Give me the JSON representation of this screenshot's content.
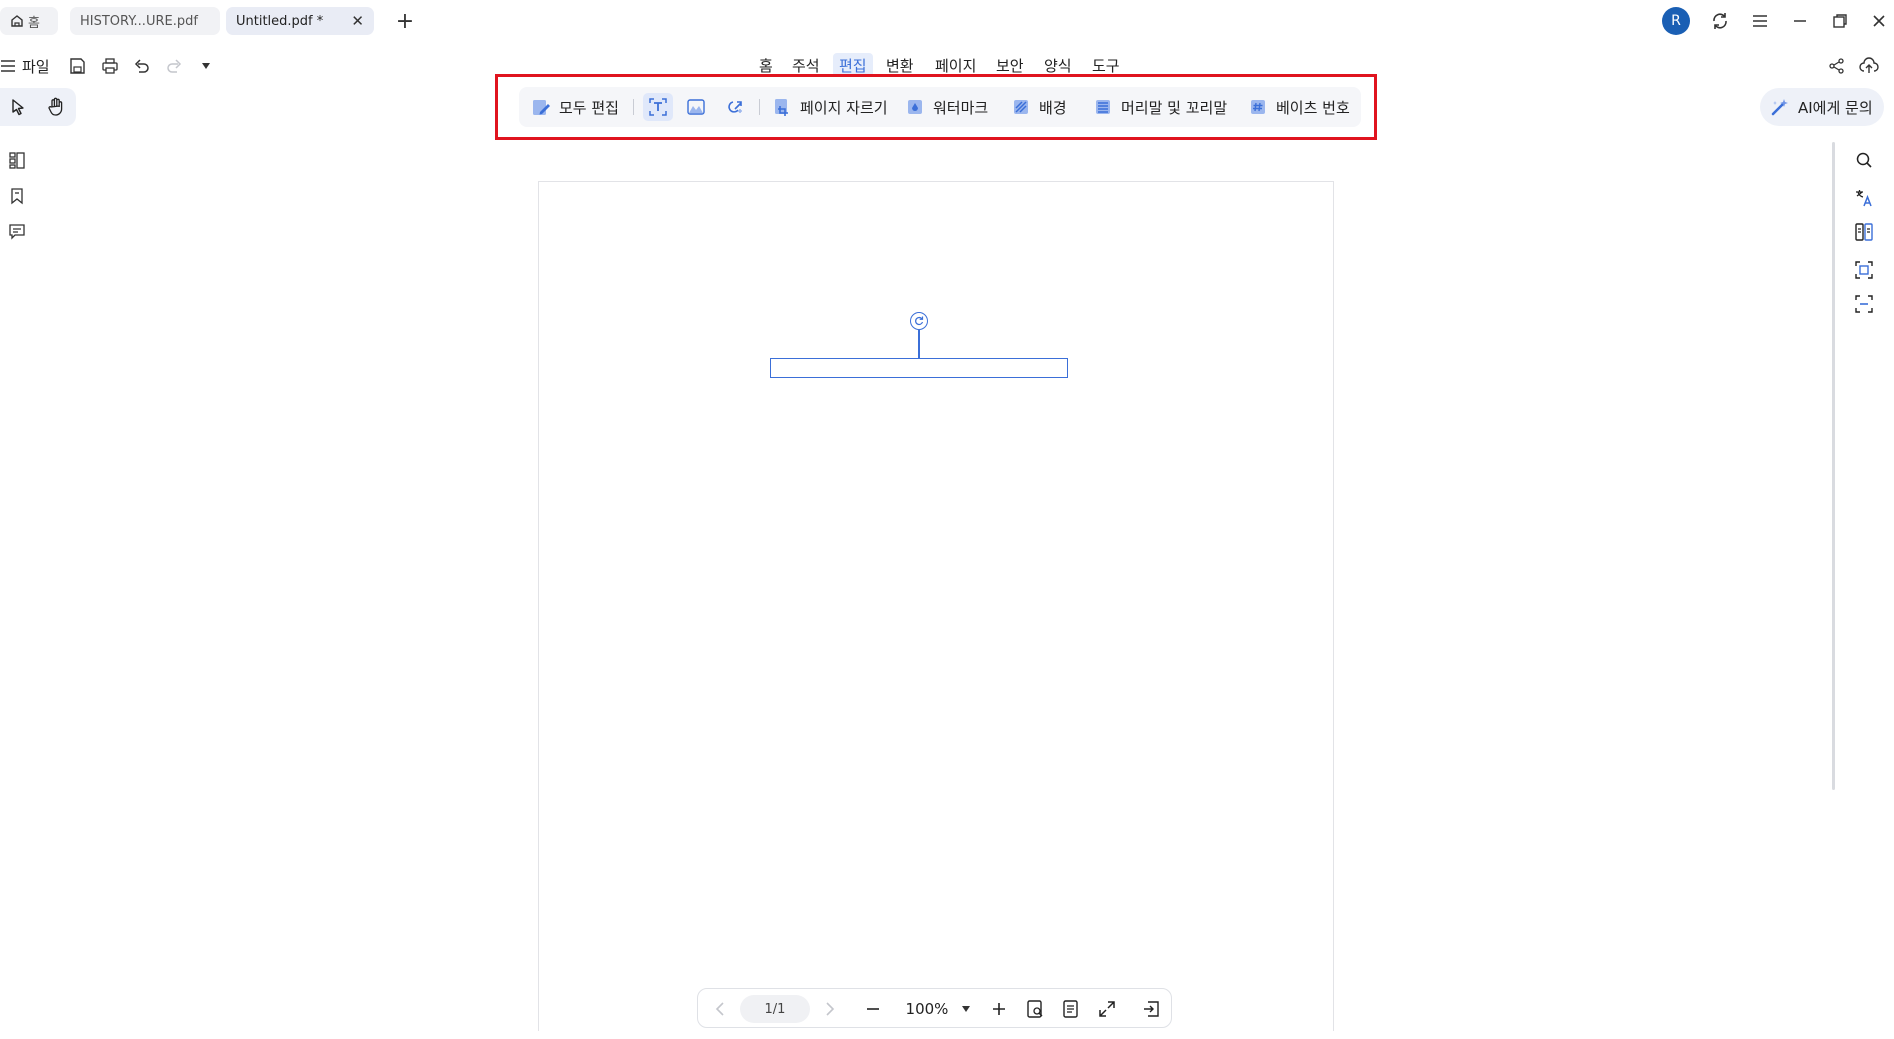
{
  "tabs": {
    "home_label": "홈",
    "items": [
      {
        "label": "HISTORY...URE.pdf"
      },
      {
        "label": "Untitled.pdf *"
      }
    ],
    "close_glyph": "✕",
    "new_tab_glyph": "+"
  },
  "window": {
    "avatar_initial": "R",
    "avatar_color": "#1a5fb4"
  },
  "menu": {
    "file_label": "파일",
    "tabs": [
      "홈",
      "주석",
      "편집",
      "변환",
      "페이지",
      "보안",
      "양식",
      "도구"
    ],
    "active_tab": "편집"
  },
  "edit_toolbar": {
    "edit_all_label": "모두 편집",
    "crop_label": "페이지 자르기",
    "watermark_label": "워터마크",
    "background_label": "배경",
    "header_footer_label": "머리말 및 꼬리말",
    "bates_label": "베이츠 번호"
  },
  "ai": {
    "label": "AI에게 문의"
  },
  "bottom": {
    "page_indicator": "1/1",
    "zoom": "100%"
  },
  "colors": {
    "accent": "#3b6fd8",
    "highlight": "#e0141f",
    "toolbar_bg": "#f5f6f9"
  }
}
